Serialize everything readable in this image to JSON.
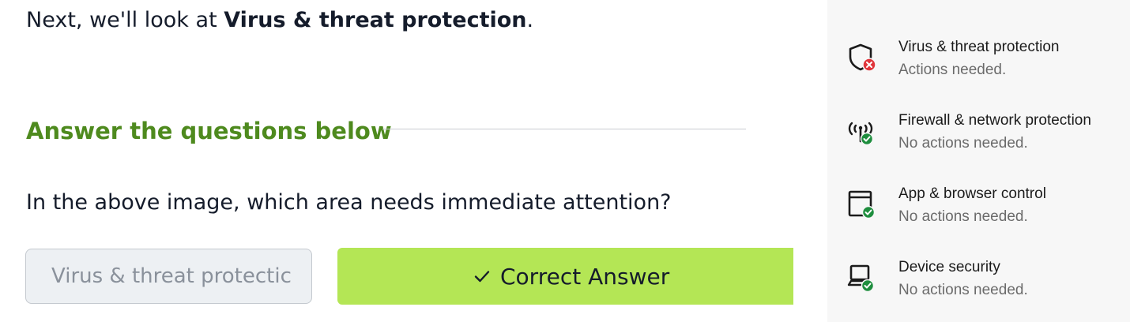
{
  "task": {
    "intro_prefix": "Next, we'll look at ",
    "intro_bold": "Virus & threat protection",
    "intro_suffix": ".",
    "questions_heading": "Answer the questions below",
    "question_text": "In the above image, which area needs immediate attention?",
    "answer_value": "Virus & threat protectic",
    "correct_button_label": "Correct Answer"
  },
  "security_panel": {
    "items": [
      {
        "title": "Virus & threat protection",
        "status": "Actions needed.",
        "icon": "shield-error-icon",
        "status_color": "#e0343a"
      },
      {
        "title": "Firewall & network protection",
        "status": "No actions needed.",
        "icon": "antenna-check-icon",
        "status_color": "#1e8e3e"
      },
      {
        "title": "App & browser control",
        "status": "No actions needed.",
        "icon": "app-window-check-icon",
        "status_color": "#1e8e3e"
      },
      {
        "title": "Device security",
        "status": "No actions needed.",
        "icon": "laptop-check-icon",
        "status_color": "#1e8e3e"
      }
    ]
  },
  "colors": {
    "heading_green": "#4e8a1e",
    "button_green": "#b4e655",
    "error_red": "#e0343a",
    "ok_green": "#1e8e3e"
  }
}
